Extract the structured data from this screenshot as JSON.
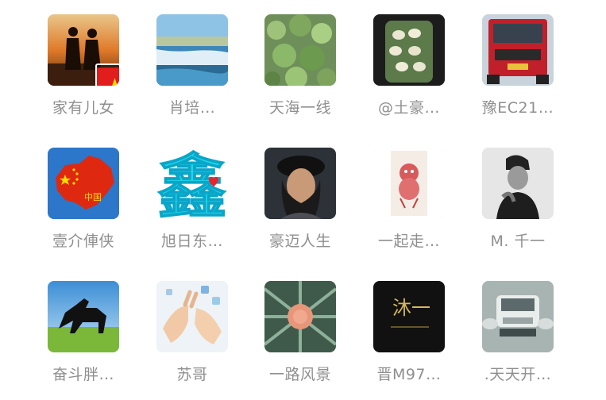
{
  "contacts": [
    {
      "name": "家有儿女",
      "icon": "couple-sunset-avatar"
    },
    {
      "name": "肖培…",
      "icon": "waterfall-avatar"
    },
    {
      "name": "天海一线",
      "icon": "green-plants-avatar"
    },
    {
      "name": "@土豪…",
      "icon": "dumplings-plate-avatar"
    },
    {
      "name": "豫EC21…",
      "icon": "red-truck-avatar"
    },
    {
      "name": "壹介俥侠",
      "icon": "china-map-flag-avatar"
    },
    {
      "name": "旭日东…",
      "icon": "xin-character-avatar"
    },
    {
      "name": "豪迈人生",
      "icon": "man-hat-portrait-avatar"
    },
    {
      "name": "一起走…",
      "icon": "paper-cut-tiger-avatar"
    },
    {
      "name": "M. 千一",
      "icon": "man-cap-bw-avatar"
    },
    {
      "name": "奋斗胖…",
      "icon": "black-horse-avatar"
    },
    {
      "name": "苏哥",
      "icon": "hands-fingers-avatar"
    },
    {
      "name": "一路风景",
      "icon": "succulent-plant-avatar"
    },
    {
      "name": "晋M97…",
      "icon": "calligraphy-black-avatar"
    },
    {
      "name": ".天天开…",
      "icon": "truck-front-avatar"
    }
  ],
  "avatar_badge": {
    "icon": "china-flag-icon"
  },
  "xin_char": "鑫",
  "map_char": "中国",
  "calli_char": "沐一"
}
